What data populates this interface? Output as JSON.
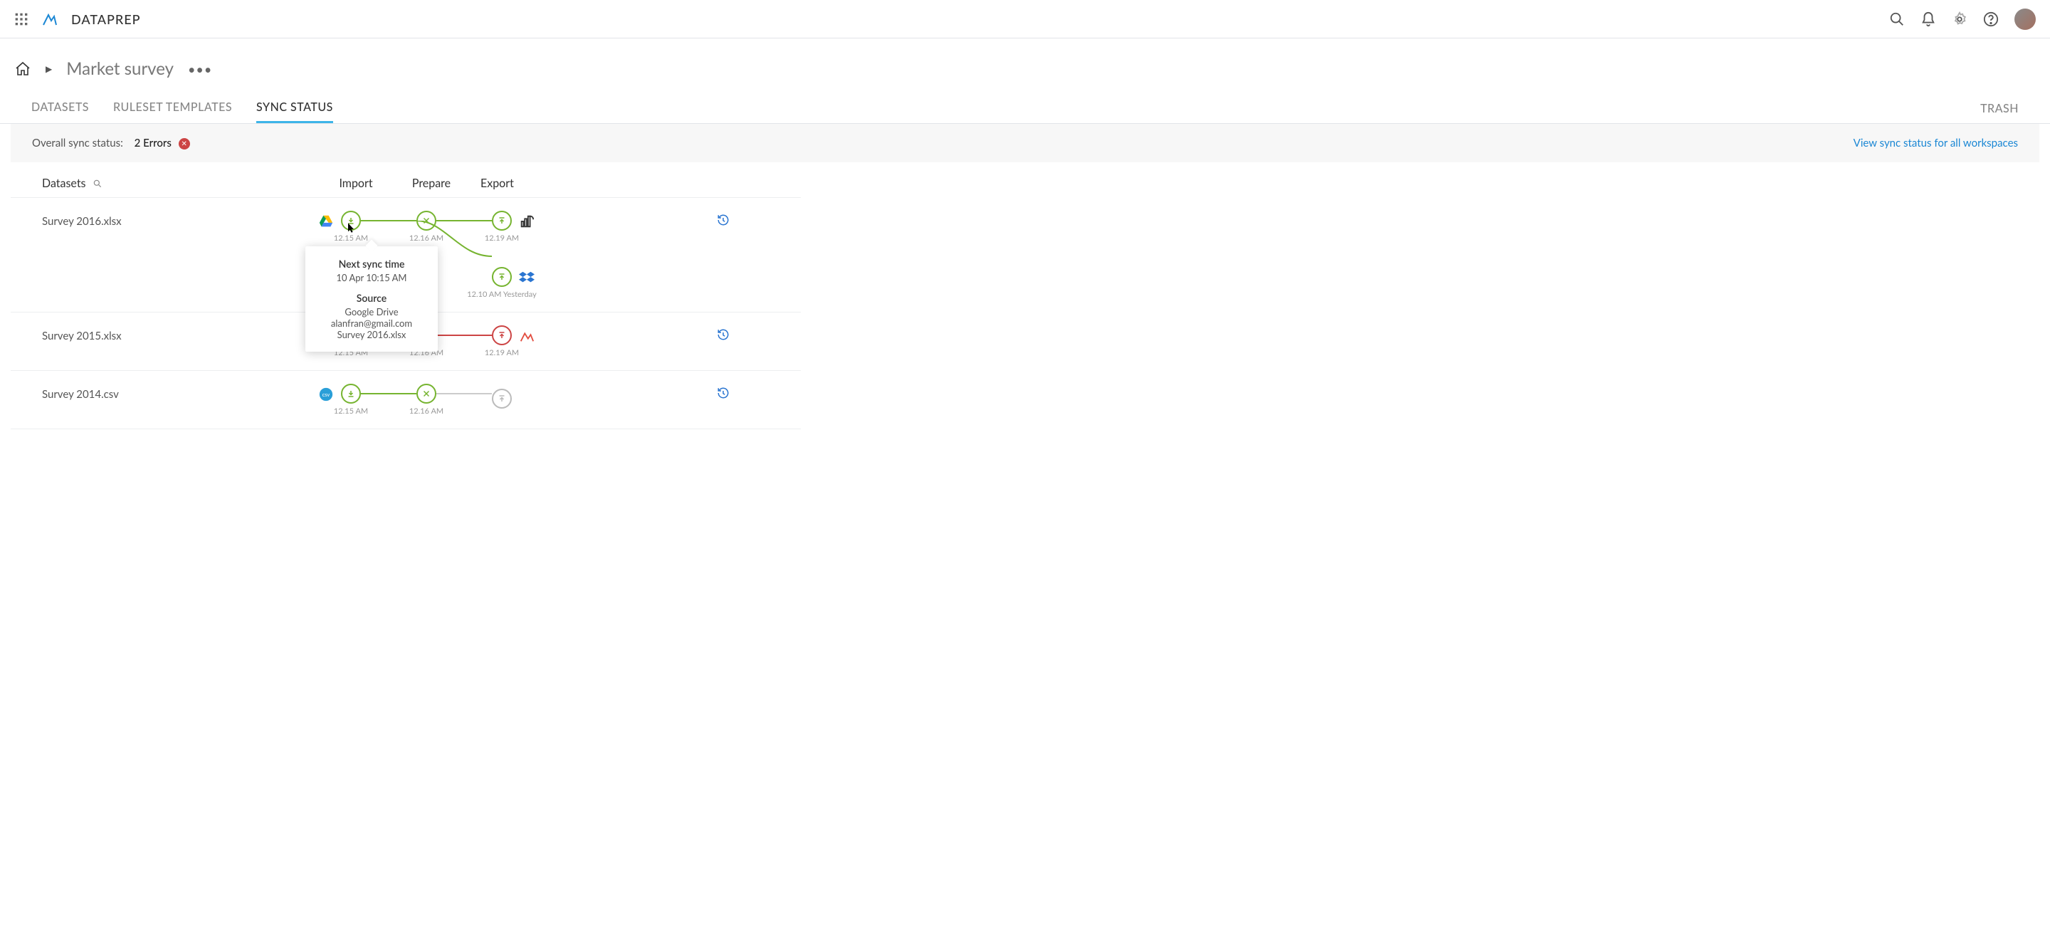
{
  "app": {
    "name": "DATAPREP"
  },
  "breadcrumb": {
    "workspace": "Market survey"
  },
  "tabs": {
    "datasets": "DATASETS",
    "ruleset_templates": "RULESET TEMPLATES",
    "sync_status": "SYNC STATUS",
    "trash": "TRASH",
    "active": "sync_status"
  },
  "status": {
    "label": "Overall sync status:",
    "value": "2 Errors",
    "link": "View sync status for all workspaces"
  },
  "columns": {
    "datasets": "Datasets",
    "import": "Import",
    "prepare": "Prepare",
    "export": "Export"
  },
  "tooltip": {
    "next_sync_head": "Next sync time",
    "next_sync_val": "10 Apr 10:15 AM",
    "source_head": "Source",
    "source_l1": "Google Drive",
    "source_l2": "alanfran@gmail.com",
    "source_l3": "Survey 2016.xlsx"
  },
  "rows": [
    {
      "name": "Survey 2016.xlsx",
      "source_icon": "gdrive",
      "import": {
        "state": "green",
        "time": "12.15 AM"
      },
      "prepare": {
        "state": "green",
        "time": "12.16 AM"
      },
      "exports": [
        {
          "state": "green",
          "time": "12.19 AM",
          "dest_icon": "powerbi"
        },
        {
          "state": "green",
          "time": "12.10 AM Yesterday",
          "dest_icon": "dropbox"
        }
      ]
    },
    {
      "name": "Survey 2015.xlsx",
      "source_icon": "local",
      "import": {
        "state": "green",
        "time": "12.15 AM"
      },
      "prepare": {
        "state": "green",
        "time": "12.16 AM"
      },
      "exports": [
        {
          "state": "red",
          "time": "12.19 AM",
          "dest_icon": "databricks"
        }
      ]
    },
    {
      "name": "Survey 2014.csv",
      "source_icon": "local-blue",
      "import": {
        "state": "green",
        "time": "12.15 AM"
      },
      "prepare": {
        "state": "green",
        "time": "12.16 AM"
      },
      "exports": [
        {
          "state": "grey",
          "time": "",
          "dest_icon": ""
        }
      ]
    }
  ]
}
